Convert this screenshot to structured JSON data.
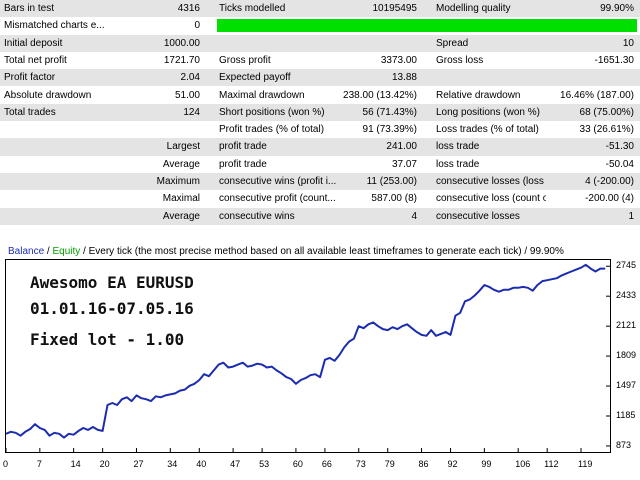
{
  "report": {
    "rows": [
      {
        "c": [
          "Bars in test",
          "4316",
          "Ticks modelled",
          "10195495",
          "Modelling quality",
          "99.90%"
        ]
      },
      {
        "c": [
          "Mismatched charts e...",
          "0",
          "",
          "",
          "",
          ""
        ]
      },
      {
        "c": [
          "Initial deposit",
          "1000.00",
          "",
          "",
          "Spread",
          "10"
        ]
      },
      {
        "c": [
          "Total net profit",
          "1721.70",
          "Gross profit",
          "3373.00",
          "Gross loss",
          "-1651.30"
        ]
      },
      {
        "c": [
          "Profit factor",
          "2.04",
          "Expected payoff",
          "13.88",
          "",
          ""
        ]
      },
      {
        "c": [
          "Absolute drawdown",
          "51.00",
          "Maximal drawdown",
          "238.00 (13.42%)",
          "Relative drawdown",
          "16.46% (187.00)"
        ]
      },
      {
        "c": [
          "Total trades",
          "124",
          "Short positions (won %)",
          "56 (71.43%)",
          "Long positions (won %)",
          "68 (75.00%)"
        ]
      },
      {
        "c": [
          "",
          "",
          "Profit trades (% of total)",
          "91 (73.39%)",
          "Loss trades (% of total)",
          "33 (26.61%)"
        ]
      },
      {
        "c": [
          "",
          "Largest",
          "profit trade",
          "241.00",
          "loss trade",
          "-51.30"
        ]
      },
      {
        "c": [
          "",
          "Average",
          "profit trade",
          "37.07",
          "loss trade",
          "-50.04"
        ]
      },
      {
        "c": [
          "",
          "Maximum",
          "consecutive wins (profit i...",
          "11 (253.00)",
          "consecutive losses (loss i...",
          "4 (-200.00)"
        ]
      },
      {
        "c": [
          "",
          "Maximal",
          "consecutive profit (count...",
          "587.00 (8)",
          "consecutive loss (count o...",
          "-200.00 (4)"
        ]
      },
      {
        "c": [
          "",
          "Average",
          "consecutive wins",
          "4",
          "consecutive losses",
          "1"
        ]
      }
    ],
    "modelling_quality_fraction": 0.999
  },
  "chart_header": {
    "balance": "Balance",
    "separator": " / ",
    "equity": "Equity",
    "rest": " / Every tick (the most precise method based on all available least timeframes to generate each tick) / 99.90%"
  },
  "annotations": {
    "line1": "Awesomo EA EURUSD",
    "line2": "01.01.16-07.05.16",
    "line3": "Fixed lot - 1.00"
  },
  "colors": {
    "balance": "#1c2cb0",
    "equity": "#00a000",
    "quality_bar": "#00e000"
  },
  "chart_data": {
    "type": "line",
    "title": "",
    "xlabel": "",
    "ylabel": "",
    "x_ticks": [
      "0",
      "7",
      "14",
      "20",
      "27",
      "34",
      "40",
      "47",
      "53",
      "60",
      "66",
      "73",
      "79",
      "86",
      "92",
      "99",
      "106",
      "112",
      "119"
    ],
    "y_ticks": [
      "873",
      "1185",
      "1497",
      "1809",
      "2121",
      "2433",
      "2745"
    ],
    "xlim": [
      0,
      125
    ],
    "ylim": [
      810,
      2810
    ],
    "grid": false,
    "series": [
      {
        "name": "Balance",
        "x": [
          0,
          1,
          2,
          3,
          4,
          5,
          6,
          7,
          8,
          9,
          10,
          11,
          12,
          13,
          14,
          15,
          16,
          17,
          18,
          19,
          20,
          21,
          22,
          23,
          24,
          25,
          26,
          27,
          28,
          29,
          30,
          31,
          32,
          33,
          34,
          35,
          36,
          37,
          38,
          39,
          40,
          41,
          42,
          43,
          44,
          45,
          46,
          47,
          48,
          49,
          50,
          51,
          52,
          53,
          54,
          55,
          56,
          57,
          58,
          59,
          60,
          61,
          62,
          63,
          64,
          65,
          66,
          67,
          68,
          69,
          70,
          71,
          72,
          73,
          74,
          75,
          76,
          77,
          78,
          79,
          80,
          81,
          82,
          83,
          84,
          85,
          86,
          87,
          88,
          89,
          90,
          91,
          92,
          93,
          94,
          95,
          96,
          97,
          98,
          99,
          100,
          101,
          102,
          103,
          104,
          105,
          106,
          107,
          108,
          109,
          110,
          111,
          112,
          113,
          114,
          115,
          116,
          117,
          118,
          119,
          120,
          121,
          122,
          123,
          124
        ],
        "y": [
          1000,
          1020,
          1010,
          980,
          1020,
          1050,
          1100,
          1060,
          1040,
          980,
          1010,
          1000,
          960,
          1000,
          990,
          1030,
          1060,
          1040,
          1070,
          1040,
          1030,
          1300,
          1320,
          1300,
          1360,
          1380,
          1340,
          1400,
          1370,
          1360,
          1340,
          1390,
          1380,
          1400,
          1410,
          1420,
          1450,
          1460,
          1500,
          1520,
          1560,
          1620,
          1600,
          1660,
          1720,
          1740,
          1690,
          1700,
          1720,
          1740,
          1700,
          1710,
          1730,
          1720,
          1690,
          1700,
          1660,
          1630,
          1590,
          1570,
          1520,
          1560,
          1580,
          1610,
          1620,
          1590,
          1770,
          1790,
          1760,
          1820,
          1900,
          1960,
          1990,
          2120,
          2100,
          2140,
          2160,
          2120,
          2090,
          2080,
          2110,
          2090,
          2120,
          2140,
          2100,
          2060,
          2030,
          2020,
          2080,
          2020,
          2040,
          2060,
          2030,
          2230,
          2260,
          2380,
          2400,
          2440,
          2490,
          2550,
          2530,
          2500,
          2480,
          2500,
          2500,
          2520,
          2520,
          2530,
          2520,
          2490,
          2550,
          2590,
          2600,
          2610,
          2620,
          2650,
          2670,
          2690,
          2710,
          2730,
          2760,
          2720,
          2690,
          2720,
          2720
        ]
      }
    ]
  }
}
